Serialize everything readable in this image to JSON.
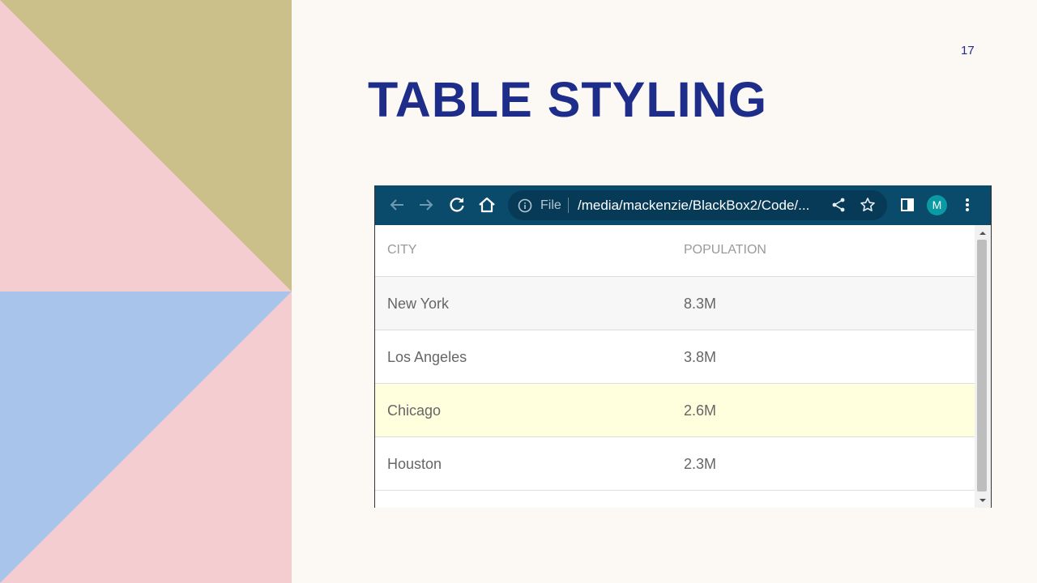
{
  "slide": {
    "title": "TABLE STYLING",
    "page_number": "17"
  },
  "decor_colors": {
    "background": "#fcf8f4",
    "pink": "#f4cdd0",
    "khaki": "#cbbf8a",
    "blue": "#a8c4ea",
    "title": "#1f2d8a"
  },
  "browser": {
    "toolbar_color": "#0a4b6c",
    "icons": [
      "back-arrow-icon",
      "forward-arrow-icon",
      "reload-icon",
      "home-icon",
      "info-icon",
      "share-icon",
      "star-icon",
      "side-panel-icon",
      "kebab-menu-icon"
    ],
    "omnibox": {
      "scheme_label": "File",
      "url": "/media/mackenzie/BlackBox2/Code/..."
    },
    "profile_initial": "M",
    "profile_color": "#0a9aa4"
  },
  "table": {
    "headers": [
      "CITY",
      "POPULATION"
    ],
    "rows": [
      {
        "city": "New York",
        "population": "8.3M",
        "highlight": "#f7f7f7"
      },
      {
        "city": "Los Angeles",
        "population": "3.8M",
        "highlight": "#ffffff"
      },
      {
        "city": "Chicago",
        "population": "2.6M",
        "highlight": "#ffffdd"
      },
      {
        "city": "Houston",
        "population": "2.3M",
        "highlight": "#ffffff"
      }
    ]
  }
}
